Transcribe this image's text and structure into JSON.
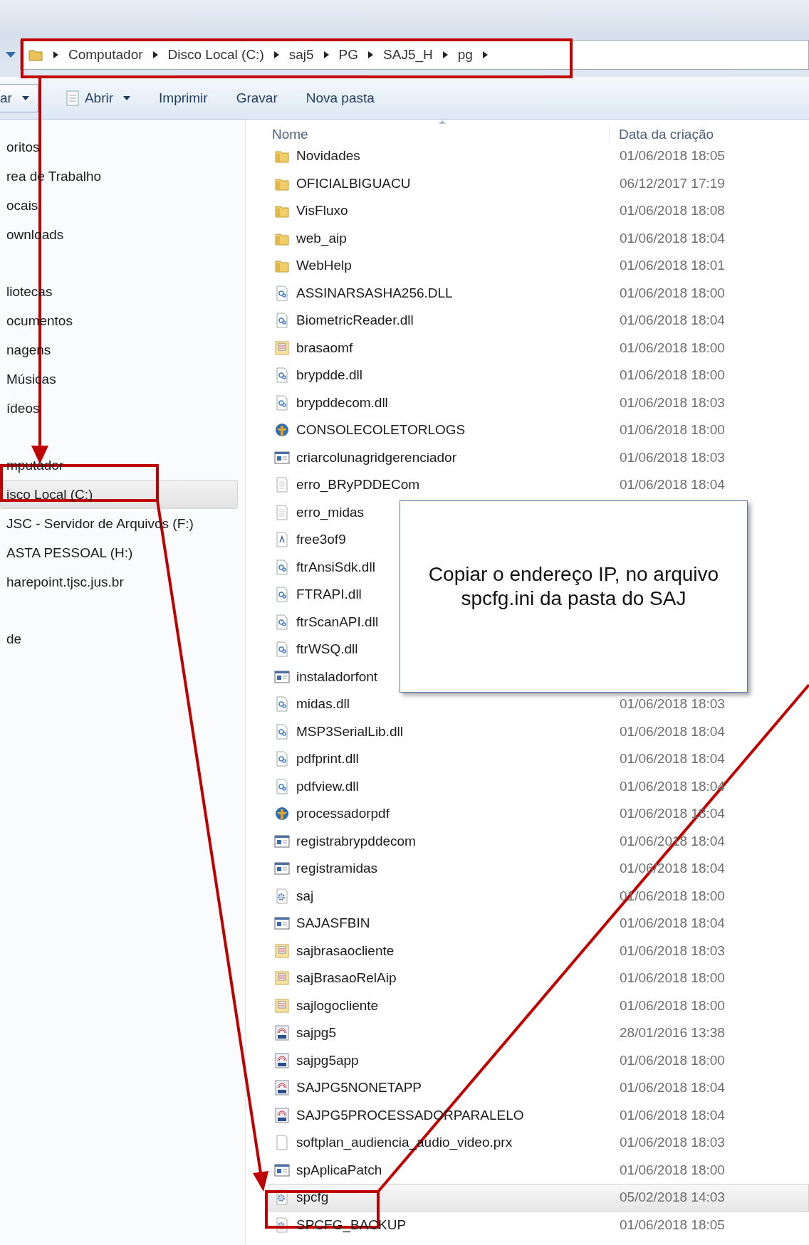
{
  "address_bar": {
    "crumbs": [
      "Computador",
      "Disco Local (C:)",
      "saj5",
      "PG",
      "SAJ5_H",
      "pg"
    ]
  },
  "toolbar": {
    "buttons": [
      {
        "label": "ar",
        "kind": "menu"
      },
      {
        "label": "Abrir",
        "kind": "open"
      },
      {
        "label": "Imprimir",
        "kind": "plain"
      },
      {
        "label": "Gravar",
        "kind": "plain"
      },
      {
        "label": "Nova pasta",
        "kind": "plain"
      }
    ]
  },
  "nav_pane": {
    "groups": [
      {
        "items": [
          {
            "label": "oritos",
            "selected": false
          },
          {
            "label": "rea de Trabalho",
            "selected": false
          },
          {
            "label": "ocais",
            "selected": false
          },
          {
            "label": "ownloads",
            "selected": false
          }
        ]
      },
      {
        "items": [
          {
            "label": "liotecas",
            "selected": false
          },
          {
            "label": "ocumentos",
            "selected": false
          },
          {
            "label": "nagens",
            "selected": false
          },
          {
            "label": "Músicas",
            "selected": false
          },
          {
            "label": "ídeos",
            "selected": false
          }
        ]
      },
      {
        "items": [
          {
            "label": "mputador",
            "selected": false
          },
          {
            "label": "isco Local (C:)",
            "selected": true
          },
          {
            "label": "JSC - Servidor de Arquivos (F:)",
            "selected": false
          },
          {
            "label": "ASTA PESSOAL (H:)",
            "selected": false
          },
          {
            "label": "harepoint.tjsc.jus.br",
            "selected": false
          }
        ]
      },
      {
        "items": [
          {
            "label": "de",
            "selected": false
          }
        ]
      }
    ]
  },
  "file_list": {
    "columns": [
      "Nome",
      "Data da criação"
    ],
    "rows": [
      {
        "name": "Novidades",
        "date": "01/06/2018 18:05",
        "kind": "folder",
        "selected": false
      },
      {
        "name": "OFICIALBIGUACU",
        "date": "06/12/2017 17:19",
        "kind": "folder",
        "selected": false
      },
      {
        "name": "VisFluxo",
        "date": "01/06/2018 18:08",
        "kind": "folder",
        "selected": false
      },
      {
        "name": "web_aip",
        "date": "01/06/2018 18:04",
        "kind": "folder",
        "selected": false
      },
      {
        "name": "WebHelp",
        "date": "01/06/2018 18:01",
        "kind": "folder",
        "selected": false
      },
      {
        "name": "ASSINARSASHA256.DLL",
        "date": "01/06/2018 18:00",
        "kind": "dll",
        "selected": false
      },
      {
        "name": "BiometricReader.dll",
        "date": "01/06/2018 18:04",
        "kind": "dll",
        "selected": false
      },
      {
        "name": "brasaomf",
        "date": "01/06/2018 18:00",
        "kind": "image",
        "selected": false
      },
      {
        "name": "brypdde.dll",
        "date": "01/06/2018 18:00",
        "kind": "dll",
        "selected": false
      },
      {
        "name": "brypddecom.dll",
        "date": "01/06/2018 18:03",
        "kind": "dll",
        "selected": false
      },
      {
        "name": "CONSOLECOLETORLOGS",
        "date": "01/06/2018 18:00",
        "kind": "app",
        "selected": false
      },
      {
        "name": "criarcolunagridgerenciador",
        "date": "01/06/2018 18:03",
        "kind": "window",
        "selected": false
      },
      {
        "name": "erro_BRyPDDECom",
        "date": "01/06/2018 18:04",
        "kind": "text",
        "selected": false
      },
      {
        "name": "erro_midas",
        "kind": "text",
        "selected": false
      },
      {
        "name": "free3of9",
        "kind": "font",
        "selected": false
      },
      {
        "name": "ftrAnsiSdk.dll",
        "kind": "dll",
        "selected": false
      },
      {
        "name": "FTRAPI.dll",
        "kind": "dll",
        "selected": false
      },
      {
        "name": "ftrScanAPI.dll",
        "kind": "dll",
        "selected": false
      },
      {
        "name": "ftrWSQ.dll",
        "kind": "dll",
        "selected": false
      },
      {
        "name": "instaladorfont",
        "kind": "window",
        "selected": false
      },
      {
        "name": "midas.dll",
        "date": "01/06/2018 18:03",
        "kind": "dll",
        "selected": false
      },
      {
        "name": "MSP3SerialLib.dll",
        "date": "01/06/2018 18:04",
        "kind": "dll",
        "selected": false
      },
      {
        "name": "pdfprint.dll",
        "date": "01/06/2018 18:04",
        "kind": "dll",
        "selected": false
      },
      {
        "name": "pdfview.dll",
        "date": "01/06/2018 18:04",
        "kind": "dll",
        "selected": false
      },
      {
        "name": "processadorpdf",
        "date": "01/06/2018 18:04",
        "kind": "app",
        "selected": false
      },
      {
        "name": "registrabrypddecom",
        "date": "01/06/2018 18:04",
        "kind": "window",
        "selected": false
      },
      {
        "name": "registramidas",
        "date": "01/06/2018 18:04",
        "kind": "window",
        "selected": false
      },
      {
        "name": "saj",
        "date": "01/06/2018 18:00",
        "kind": "config",
        "selected": false
      },
      {
        "name": "SAJASFBIN",
        "date": "01/06/2018 18:04",
        "kind": "window",
        "selected": false
      },
      {
        "name": "sajbrasaocliente",
        "date": "01/06/2018 18:03",
        "kind": "image",
        "selected": false
      },
      {
        "name": "sajBrasaoRelAip",
        "date": "01/06/2018 18:00",
        "kind": "image",
        "selected": false
      },
      {
        "name": "sajlogocliente",
        "date": "01/06/2018 18:00",
        "kind": "image",
        "selected": false
      },
      {
        "name": "sajpg5",
        "date": "28/01/2016 13:38",
        "kind": "saj",
        "selected": false
      },
      {
        "name": "sajpg5app",
        "date": "01/06/2018 18:00",
        "kind": "saj",
        "selected": false
      },
      {
        "name": "SAJPG5NONETAPP",
        "date": "01/06/2018 18:04",
        "kind": "saj",
        "selected": false
      },
      {
        "name": "SAJPG5PROCESSADORPARALELO",
        "date": "01/06/2018 18:04",
        "kind": "saj",
        "selected": false
      },
      {
        "name": "softplan_audiencia_audio_video.prx",
        "date": "01/06/2018 18:03",
        "kind": "blank",
        "selected": false
      },
      {
        "name": "spAplicaPatch",
        "date": "01/06/2018 18:00",
        "kind": "window",
        "selected": false
      },
      {
        "name": "spcfg",
        "date": "05/02/2018 14:03",
        "kind": "config",
        "selected": true
      },
      {
        "name": "SPCFG_BACKUP",
        "date": "01/06/2018 18:05",
        "kind": "config",
        "selected": false
      }
    ]
  },
  "callout": {
    "text": "Copiar o endereço IP, no arquivo spcfg.ini da pasta do SAJ"
  }
}
